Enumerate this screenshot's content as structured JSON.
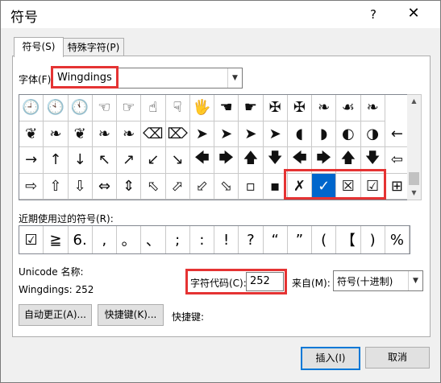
{
  "dialog": {
    "title": "符号",
    "help": "?",
    "close": "✕"
  },
  "tabs": [
    {
      "label": "符号(S)"
    },
    {
      "label": "特殊字符(P)"
    }
  ],
  "font": {
    "label": "字体(F):",
    "value": "Wingdings"
  },
  "grid": {
    "rows": [
      [
        "🕘",
        "🕙",
        "🕚",
        "☜",
        "☞",
        "☝",
        "☟",
        "🖐",
        "☚",
        "☛",
        "✠",
        "✠",
        "❧",
        "☙",
        "❧"
      ],
      [
        "❦",
        "❧",
        "❦",
        "❧",
        "❧",
        "⌫",
        "⌦",
        "➤",
        "➤",
        "➤",
        "➤",
        "◖",
        "◗",
        "◐",
        "◑",
        "←"
      ],
      [
        "→",
        "↑",
        "↓",
        "↖",
        "↗",
        "↙",
        "↘",
        "🡄",
        "🡆",
        "🡅",
        "🡇",
        "🡄",
        "🡆",
        "🡅",
        "🡇",
        "⇦"
      ],
      [
        "⇨",
        "⇧",
        "⇩",
        "⇔",
        "⇕",
        "⬁",
        "⬀",
        "⬃",
        "⬂",
        "▫",
        "▪",
        "✗",
        "✓",
        "☒",
        "☑",
        "⊞"
      ]
    ],
    "selected_symbol": "✓"
  },
  "recent": {
    "label": "近期使用过的符号(R):",
    "symbols": [
      "☑",
      "≧",
      "6.",
      ",",
      "。",
      "、",
      ";",
      ":",
      "!",
      "?",
      "“",
      "”",
      "(",
      "【",
      ")",
      "%"
    ]
  },
  "unicode_name": {
    "label": "Unicode 名称:",
    "value": "Wingdings: 252"
  },
  "char_code": {
    "label": "字符代码(C):",
    "value": "252"
  },
  "from": {
    "label": "来自(M):",
    "value": "符号(十进制)"
  },
  "buttons": {
    "autocorrect": "自动更正(A)...",
    "shortcut_key": "快捷键(K)...",
    "shortcut_label": "快捷键:",
    "insert": "插入(I)",
    "cancel": "取消"
  }
}
